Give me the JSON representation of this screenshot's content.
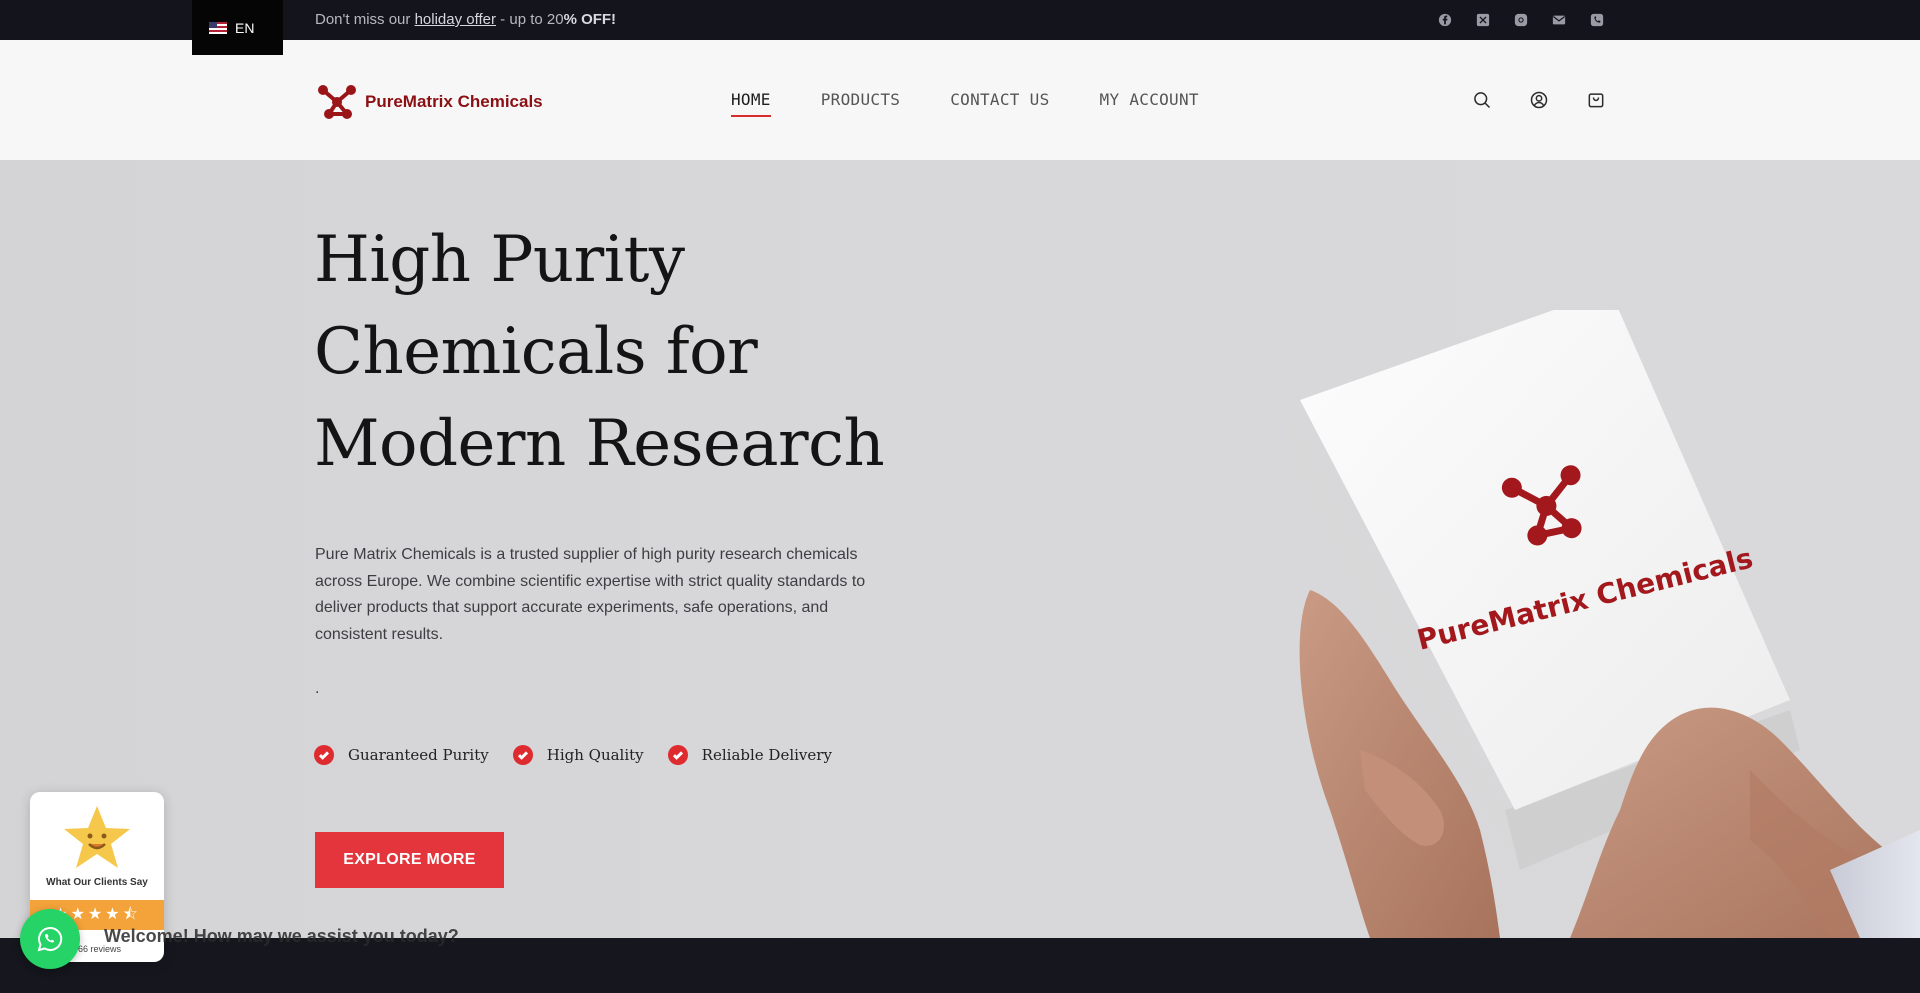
{
  "topbar": {
    "language": "EN",
    "promo_prefix": "Don't miss our ",
    "promo_link": "holiday offer",
    "promo_middle": " - up to 20",
    "promo_bold": "% OFF!",
    "social": [
      "facebook-icon",
      "x-icon",
      "instagram-icon",
      "mail-icon",
      "phone-icon"
    ]
  },
  "header": {
    "logo_text": "PureMatrix Chemicals",
    "nav": [
      "HOME",
      "PRODUCTS",
      "CONTACT US",
      "MY ACCOUNT"
    ],
    "active_nav": "HOME",
    "icons": [
      "search-icon",
      "account-icon",
      "cart-icon"
    ]
  },
  "hero": {
    "title_line1": "High Purity",
    "title_line2": "Chemicals for",
    "title_line3": "Modern Research",
    "description": "Pure Matrix Chemicals is a trusted supplier of high purity research chemicals across Europe. We combine scientific expertise with strict quality standards to deliver products that support accurate experiments, safe operations, and consistent results.",
    "dot": ".",
    "features": [
      "Guaranteed Purity",
      "High Quality",
      "Reliable Delivery"
    ],
    "cta": "EXPLORE MORE",
    "box_label": "PureMatrix Chemicals"
  },
  "widgets": {
    "reviews_title": "What Our Clients Say",
    "reviews_stars": "★★★★⯪",
    "reviews_count": "66 reviews",
    "chat_welcome": "Welcome! How may we assist you today?"
  },
  "colors": {
    "accent": "#e3353b",
    "brand": "#8a1014",
    "topbar": "#14141c",
    "whatsapp": "#25d366"
  }
}
